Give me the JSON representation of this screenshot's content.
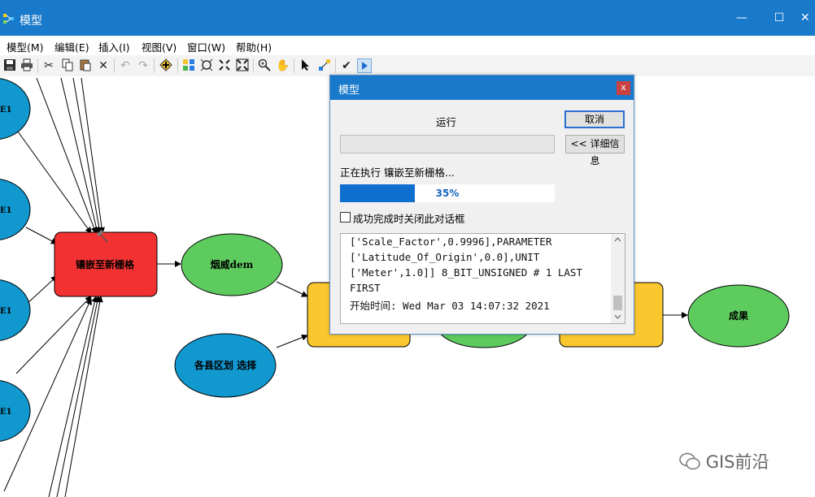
{
  "window": {
    "title": "模型",
    "min": "—",
    "max": "☐",
    "close": "✕"
  },
  "menu": [
    "编辑(E)",
    "插入(I)",
    "视图(V)",
    "窗口(W)",
    "帮助(H)"
  ],
  "menu_first": "模型(M)",
  "toolbar": {
    "icons": [
      "save-icon",
      "print-icon",
      "cut-icon",
      "copy-icon",
      "paste-icon",
      "delete-icon",
      "undo-icon",
      "redo-icon",
      "add-data-icon",
      "auto-layout-icon",
      "full-extent-icon",
      "zoom-in-fixed-icon",
      "zoom-out-fixed-icon",
      "zoom-in-icon",
      "pan-icon",
      "select-icon",
      "connect-icon",
      "validate-icon",
      "run-icon"
    ]
  },
  "model": {
    "left_nodes": [
      "E1",
      "E1",
      "E1",
      "E1"
    ],
    "tool_node": "镶嵌至新栅格",
    "output_node": "烟威dem",
    "input_node": "各县区划 选择",
    "result_node": "成果"
  },
  "dialog": {
    "title": "模型",
    "close": "x",
    "run_label": "运行",
    "cancel_button": "取消",
    "details_button": "<< 详细信息",
    "executing_text": "正在执行 镶嵌至新栅格...",
    "progress_text": "35%",
    "progress_value": 0.35,
    "close_checkbox_label": "成功完成时关闭此对话框",
    "log_lines": [
      "['Scale_Factor',0.9996],PARAMETER",
      "['Latitude_Of_Origin',0.0],UNIT",
      "['Meter',1.0]] 8_BIT_UNSIGNED # 1 LAST",
      "FIRST",
      "开始时间: Wed Mar 03 14:07:32 2021"
    ]
  },
  "watermark": "GIS前沿",
  "colors": {
    "tool_red": "#f23232",
    "output_green": "#5ecb5e",
    "input_blue": "#1198cf",
    "tool_yellow": "#fbc72f",
    "titlebar_blue": "#1979ca"
  }
}
